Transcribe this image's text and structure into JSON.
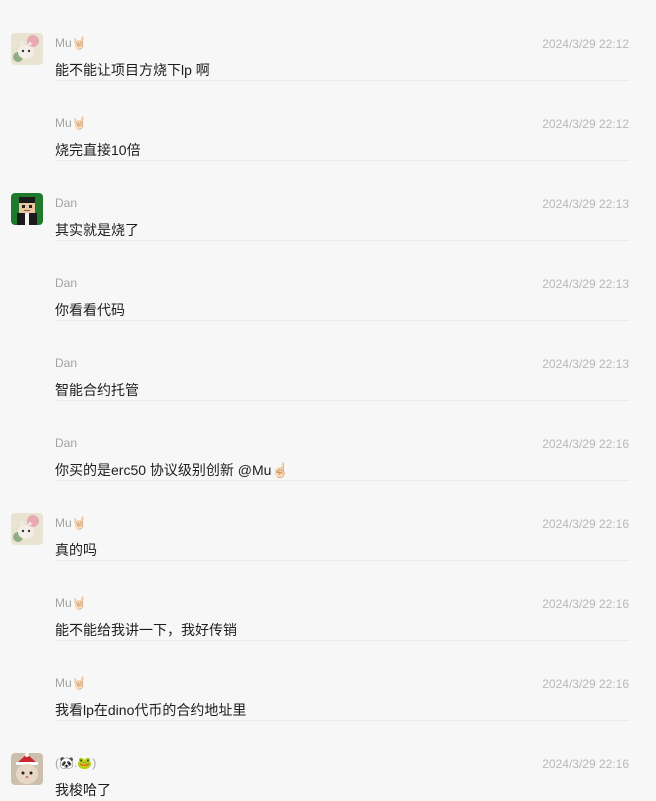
{
  "messages": [
    {
      "sender": "Mu🤘🏻",
      "time": "2024/3/29 22:12",
      "text": "能不能让项目方烧下lp 啊",
      "avatar": "cat-flower-avatar"
    },
    {
      "sender": "Mu🤘🏻",
      "time": "2024/3/29 22:12",
      "text": "烧完直接10倍",
      "avatar": ""
    },
    {
      "sender": "Dan",
      "time": "2024/3/29 22:13",
      "text": "其实就是烧了",
      "avatar": "pixel-character-avatar"
    },
    {
      "sender": "Dan",
      "time": "2024/3/29 22:13",
      "text": "你看看代码",
      "avatar": ""
    },
    {
      "sender": "Dan",
      "time": "2024/3/29 22:13",
      "text": "智能合约托管",
      "avatar": ""
    },
    {
      "sender": "Dan",
      "time": "2024/3/29 22:16",
      "text": "你买的是erc50 协议级别创新 @Mu☝🏻",
      "avatar": ""
    },
    {
      "sender": "Mu🤘🏻",
      "time": "2024/3/29 22:16",
      "text": "真的吗",
      "avatar": "cat-flower-avatar"
    },
    {
      "sender": "Mu🤘🏻",
      "time": "2024/3/29 22:16",
      "text": "能不能给我讲一下，我好传销",
      "avatar": ""
    },
    {
      "sender": "Mu🤘🏻",
      "time": "2024/3/29 22:16",
      "text": "我看lp在dino代币的合约地址里",
      "avatar": ""
    },
    {
      "sender": "(🐼.🐸)",
      "time": "2024/3/29 22:16",
      "text": "我梭哈了",
      "avatar": "christmas-cat-avatar"
    }
  ]
}
